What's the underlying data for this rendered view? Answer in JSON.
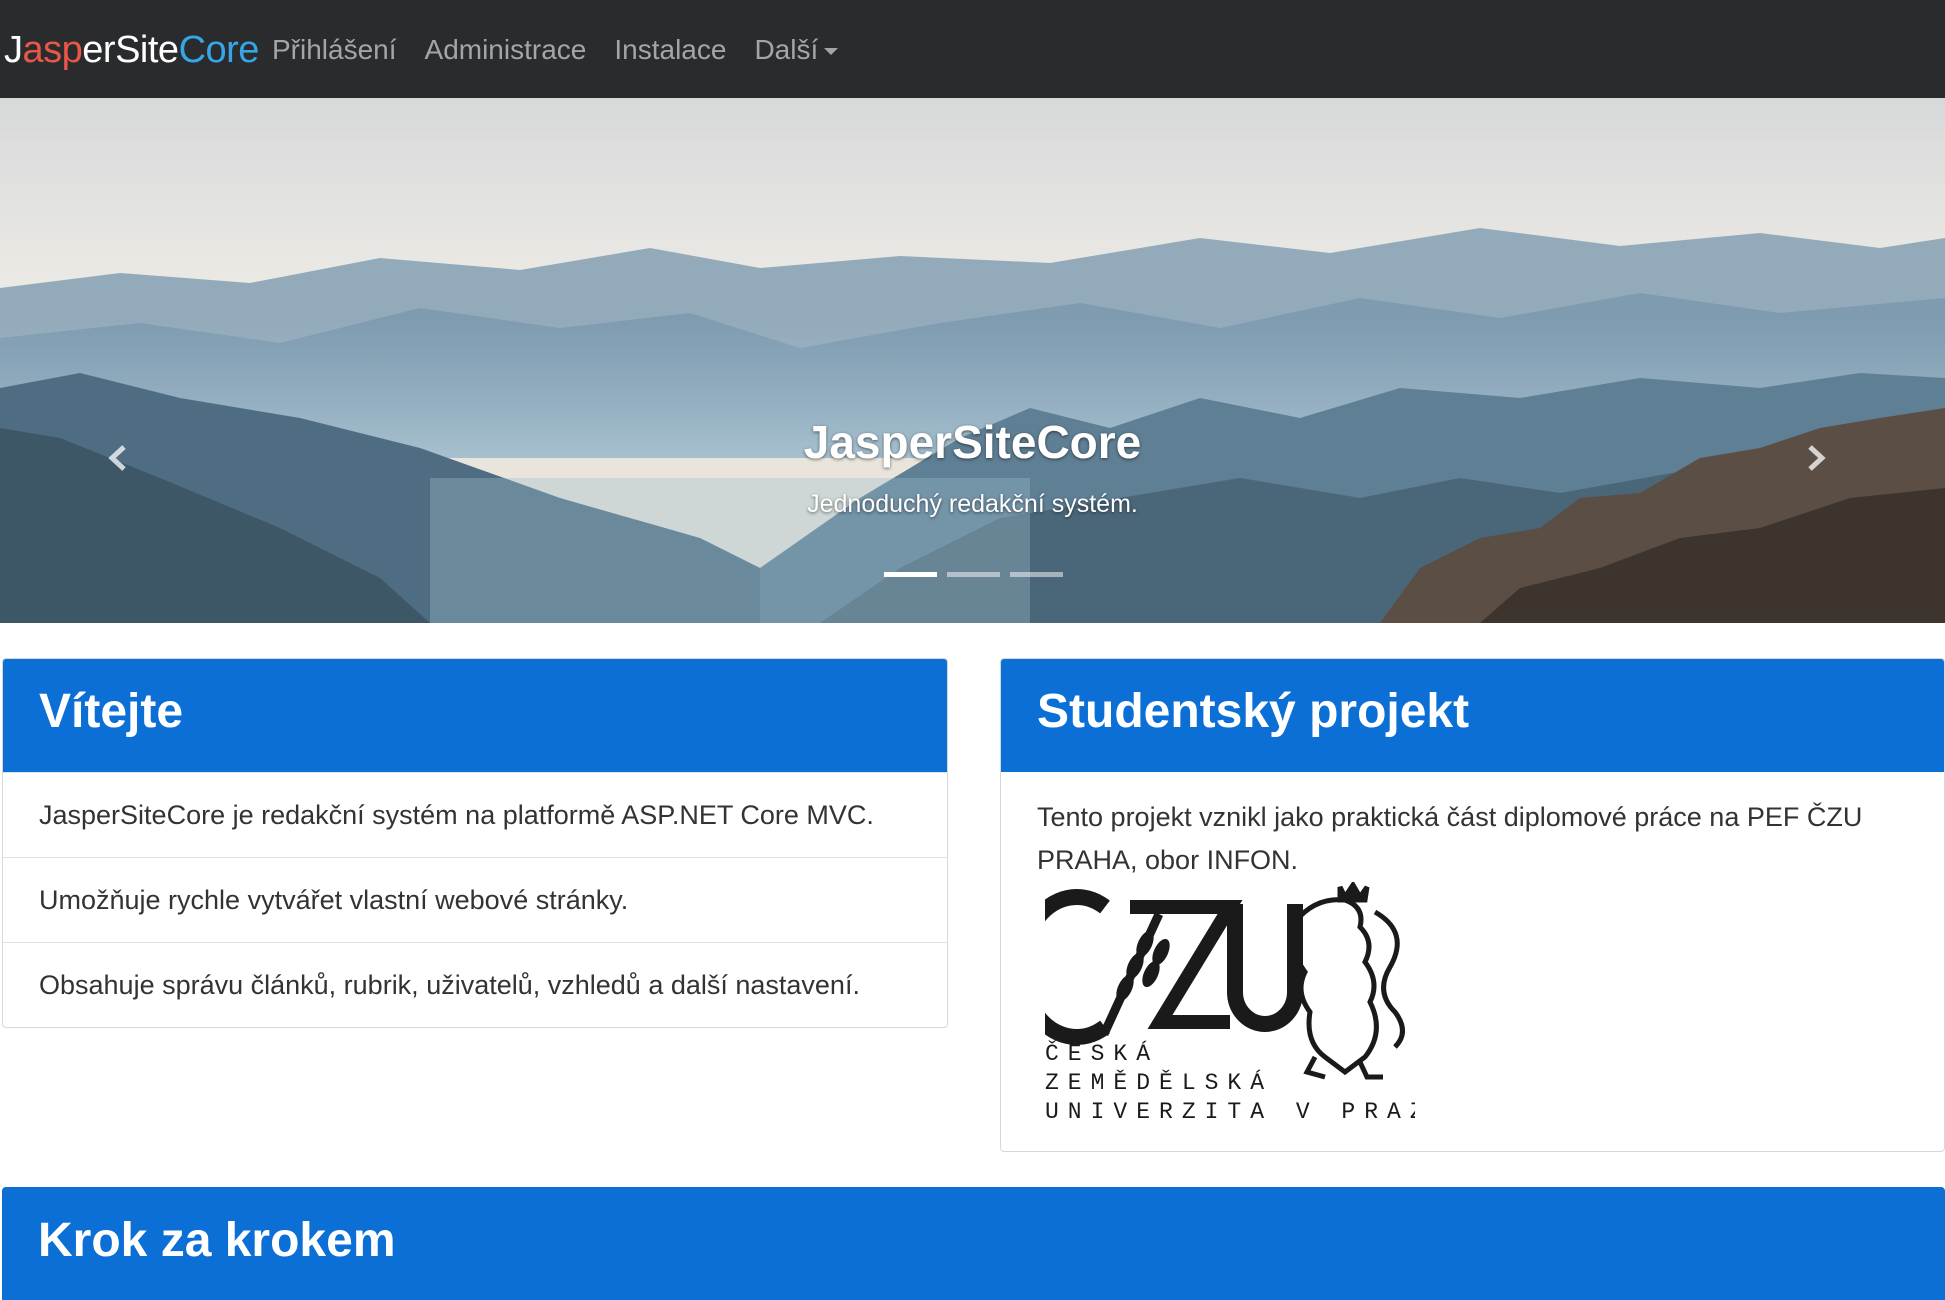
{
  "nav": {
    "brand": {
      "part1": "J",
      "part2": "asp",
      "part3": "erSite",
      "part4": "Core"
    },
    "links": [
      "Přihlášení",
      "Administrace",
      "Instalace",
      "Další"
    ]
  },
  "carousel": {
    "title": "JasperSiteCore",
    "subtitle": "Jednoduchý redakční systém.",
    "slide_count": 3,
    "active_slide": 1
  },
  "panels": {
    "welcome": {
      "title": "Vítejte",
      "items": [
        "JasperSiteCore je redakční systém na platformě ASP.NET Core MVC.",
        "Umožňuje rychle vytvářet vlastní webové stránky.",
        "Obsahuje správu článků, rubrik, uživatelů, vzhledů a další nastavení."
      ]
    },
    "student": {
      "title": "Studentský projekt",
      "text": "Tento projekt vznikl jako praktická část diplomové práce na PEF ČZU PRAHA, obor INFON.",
      "logo_lines": [
        "ČESKÁ",
        "ZEMĚDĚLSKÁ",
        "UNIVERZITA V PRAZE"
      ]
    },
    "steps": {
      "title": "Krok za krokem"
    }
  },
  "colors": {
    "navbar_bg": "#2a2b2d",
    "nav_link": "#a3a5a8",
    "brand_white": "#ffffff",
    "brand_red": "#e8574a",
    "brand_blue": "#35a6e8",
    "panel_heading": "#0b6fd6"
  },
  "icons": [
    "chevron-left-icon",
    "chevron-right-icon",
    "caret-down-icon",
    "czu-logo"
  ]
}
